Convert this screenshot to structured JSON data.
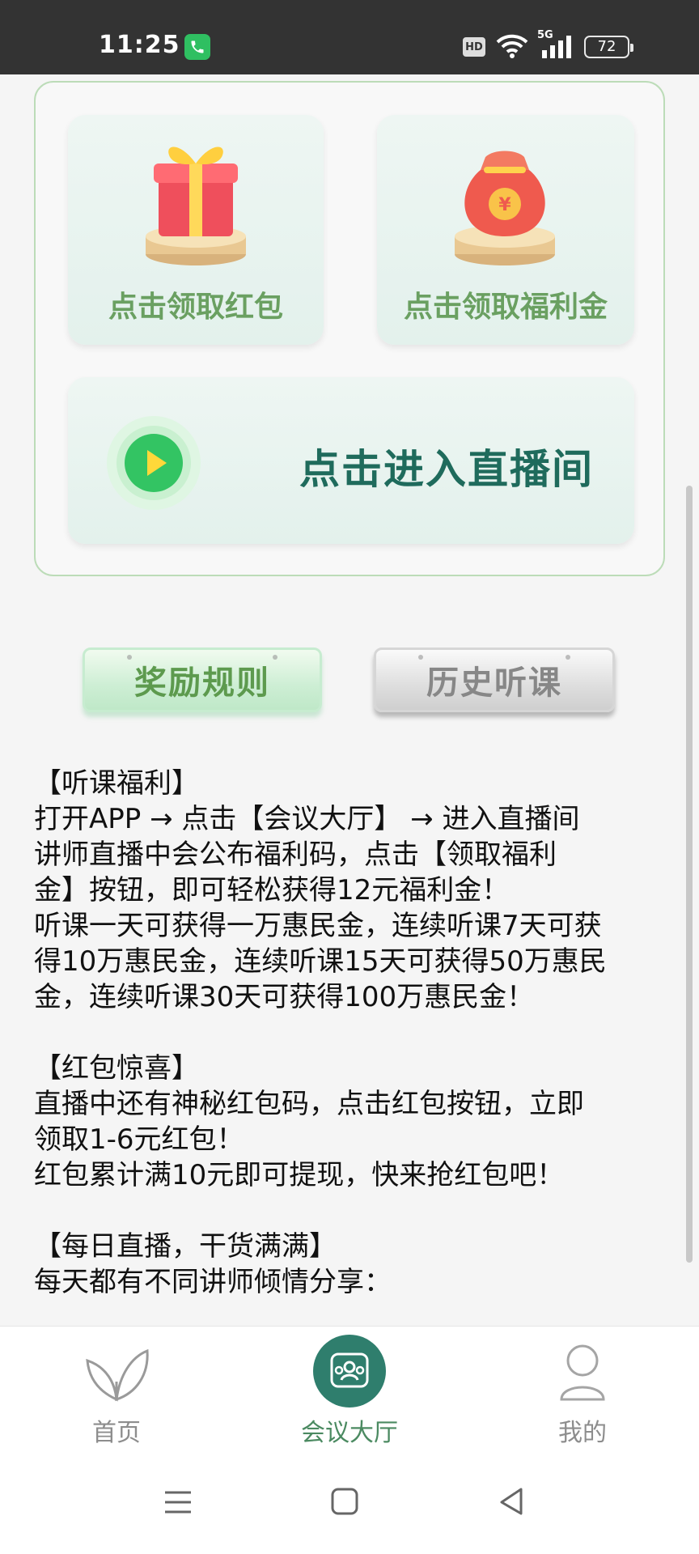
{
  "status_bar": {
    "time": "11:25",
    "hd": "HD",
    "network": "5G",
    "battery": "72"
  },
  "card": {
    "red_packet_label": "点击领取红包",
    "welfare_label": "点击领取福利金",
    "live_label": "点击进入直播间",
    "welfare_bag_symbol": "¥"
  },
  "tabs": {
    "rules_label": "奖励规则",
    "history_label": "历史听课"
  },
  "content": {
    "lines": [
      "【听课福利】",
      "打开APP → 点击【会议大厅】 → 进入直播间",
      "讲师直播中会公布福利码，点击【领取福利",
      "金】按钮，即可轻松获得12元福利金！",
      "听课一天可获得一万惠民金，连续听课7天可获",
      "得10万惠民金，连续听课15天可获得50万惠民",
      "金，连续听课30天可获得100万惠民金！",
      "",
      "【红包惊喜】",
      "直播中还有神秘红包码，点击红包按钮，立即",
      "领取1-6元红包！",
      "红包累计满10元即可提现，快来抢红包吧！",
      "",
      "【每日直播，干货满满】",
      "每天都有不同讲师倾情分享："
    ]
  },
  "bottom_nav": {
    "home_label": "首页",
    "hall_label": "会议大厅",
    "me_label": "我的"
  },
  "colors": {
    "status_bar_bg": "#333333",
    "accent_green": "#6aa061",
    "live_text": "#1f6b5c",
    "nav_active": "#4b8a61",
    "nav_inactive": "#8d8d8d"
  }
}
